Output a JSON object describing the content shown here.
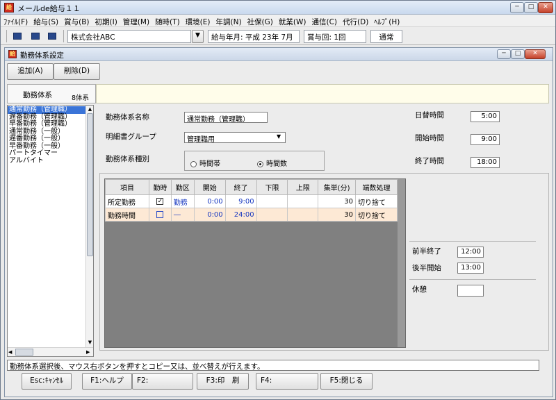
{
  "app": {
    "title": "メールde給与１１"
  },
  "menu": [
    "ﾌｧｲﾙ(F)",
    "給与(S)",
    "賞与(B)",
    "初期(I)",
    "管理(M)",
    "随時(T)",
    "環境(E)",
    "年調(N)",
    "社保(G)",
    "就業(W)",
    "通信(C)",
    "代行(D)",
    "ﾍﾙﾌﾟ(H)"
  ],
  "toolbar": {
    "company": "株式会社ABC",
    "pay_month": "給与年月: 平成 23年  7月",
    "bonus_count": "賞与回: 1回",
    "mode": "通常"
  },
  "form": {
    "title": "勤務体系設定",
    "add_button": "追加(A)",
    "delete_button": "削除(D)",
    "list_tab_label": "勤務体系",
    "list_count": "8体系",
    "work_types": [
      "通常勤務（管理職）",
      "遅番勤務（管理職）",
      "早番勤務（管理職）",
      "通常勤務（一般）",
      "遅番勤務（一般）",
      "早番勤務（一般）",
      "パートタイマー",
      "アルバイト"
    ],
    "name_label": "勤務体系名称",
    "name_value": "通常勤務（管理職）",
    "group_label": "明細書グループ",
    "group_value": "管理職用",
    "type_label": "勤務体系種別",
    "type_option_1": "時間帯",
    "type_option_2": "時間数",
    "type_selected": "時間数",
    "date_change_label": "日替時間",
    "date_change_value": "5:00",
    "start_label": "開始時間",
    "start_value": "9:00",
    "end_label": "終了時間",
    "end_value": "18:00",
    "first_half_end_label": "前半終了",
    "first_half_end_value": "12:00",
    "second_half_start_label": "後半開始",
    "second_half_start_value": "13:00",
    "break_label": "休憩",
    "break_value": ""
  },
  "grid": {
    "headers": [
      "項目",
      "勤時",
      "勤区",
      "開始",
      "終了",
      "下限",
      "上限",
      "集単(分)",
      "端数処理"
    ],
    "rows": [
      {
        "item": "所定勤務",
        "checked": true,
        "kubun": "勤務",
        "start": "0:00",
        "end": "9:00",
        "lower": "",
        "upper": "",
        "unit": "30",
        "rounding": "切り捨て"
      },
      {
        "item": "勤務時間",
        "checked": false,
        "kubun": "―",
        "start": "0:00",
        "end": "24:00",
        "lower": "",
        "upper": "",
        "unit": "30",
        "rounding": "切り捨て"
      }
    ]
  },
  "status_text": "勤務体系選択後、マウス右ボタンを押すとコピー又は、並べ替えが行えます。",
  "fkeys": [
    "Esc:ｷｬﾝｾﾙ",
    "F1:ヘルプ",
    "F2:",
    "F3:印　刷",
    "F4:",
    "F5:閉じる"
  ]
}
